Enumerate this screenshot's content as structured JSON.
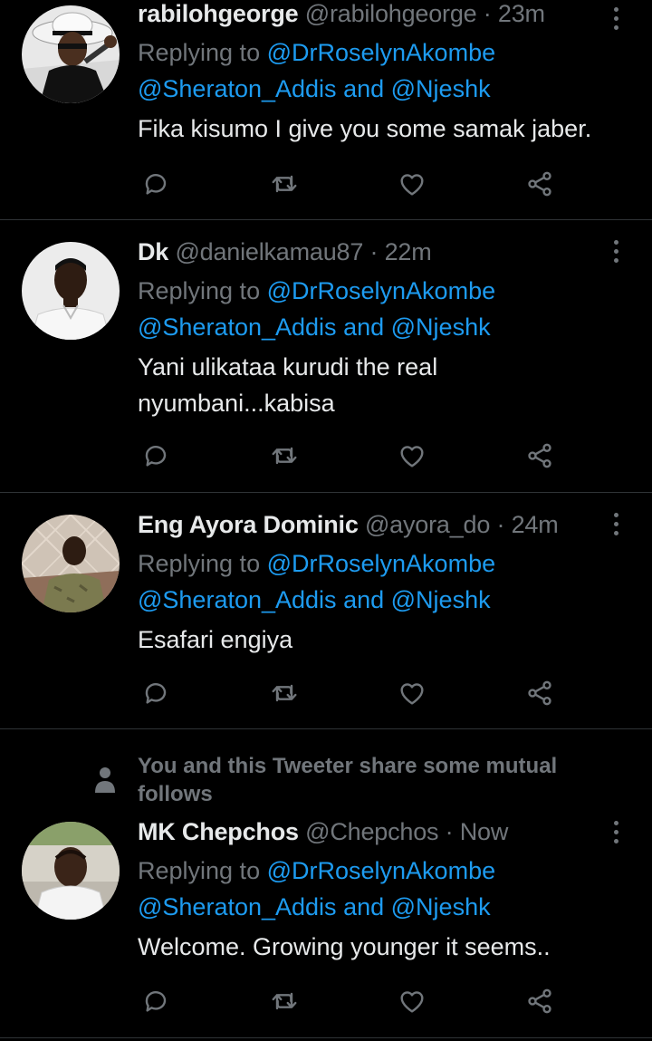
{
  "colors": {
    "background": "#000000",
    "primary_text": "#e7e9ea",
    "secondary_text": "#71767b",
    "link": "#1d9bf0",
    "divider": "#2f3336"
  },
  "action_icons": [
    "reply-icon",
    "retweet-icon",
    "like-icon",
    "share-icon"
  ],
  "tweets": [
    {
      "name": "rabilohgeorge",
      "handle": "@rabilohgeorge",
      "separator": "·",
      "time": "23m",
      "replying_to_prefix": "Replying to",
      "mention_1": "@DrRoselynAkombe",
      "mention_2": "@Sheraton_Addis",
      "and_word": "and",
      "mention_3": "@Njeshk",
      "text": "Fika kisumo I give you some samak jaber."
    },
    {
      "name": "Dk",
      "handle": "@danielkamau87",
      "separator": "·",
      "time": "22m",
      "replying_to_prefix": "Replying to",
      "mention_1": "@DrRoselynAkombe",
      "mention_2": "@Sheraton_Addis",
      "and_word": "and",
      "mention_3": "@Njeshk",
      "text_line_1": "Yani ulikataa kurudi the real",
      "text_line_2": "nyumbani...kabisa"
    },
    {
      "name": "Eng Ayora Dominic",
      "handle": "@ayora_do",
      "separator": "·",
      "time": "24m",
      "replying_to_prefix": "Replying to",
      "mention_1": "@DrRoselynAkombe",
      "mention_2": "@Sheraton_Addis",
      "and_word": "and",
      "mention_3": "@Njeshk",
      "text": "Esafari engiya"
    },
    {
      "social_context_line_1": "You and this Tweeter share some mutual",
      "social_context_line_2": "follows",
      "name": "MK Chepchos",
      "handle": "@Chepchos",
      "separator": "·",
      "time": "Now",
      "replying_to_prefix": "Replying to",
      "mention_1": "@DrRoselynAkombe",
      "mention_2": "@Sheraton_Addis",
      "and_word": "and",
      "mention_3": "@Njeshk",
      "text": "Welcome. Growing younger it seems.."
    }
  ]
}
